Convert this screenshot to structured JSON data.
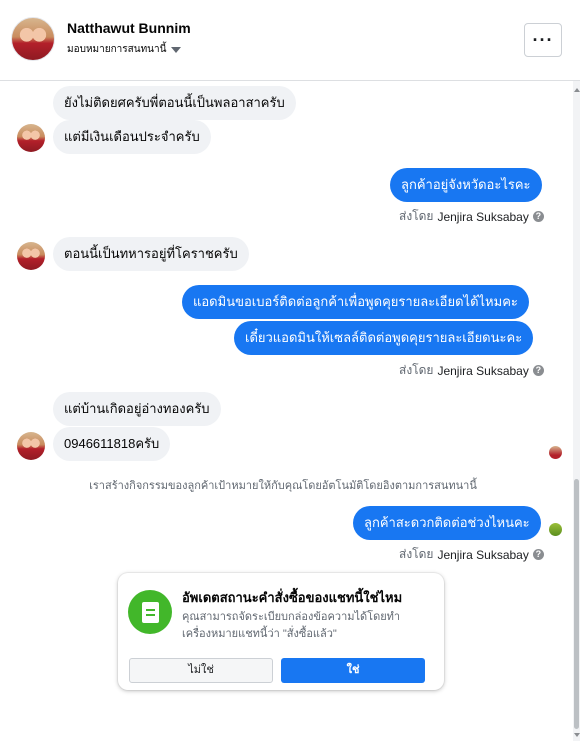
{
  "header": {
    "contact_name": "Natthawut Bunnim",
    "assign_label": "มอบหมายการสนทนานี้",
    "more_label": "···"
  },
  "messages": {
    "m1": "ยังไม่ติดยศครับพี่ตอนนี้เป็นพลอาสาครับ",
    "m2": "แต่มีเงินเดือนประจำครับ",
    "m3": "ลูกค้าอยู่จังหวัดอะไรคะ",
    "m4": "ตอนนี้เป็นทหารอยู่ที่โคราชครับ",
    "m5": "แอดมินขอเบอร์ติดต่อลูกค้าเพื่อพูดคุยรายละเอียดได้ไหมคะ",
    "m6": "เดี๋ยวแอดมินให้เซลล์ติดต่อพูดคุยรายละเอียดนะคะ",
    "m7": "แต่บ้านเกิดอยู่อ่างทองครับ",
    "m8": "0946611818ครับ",
    "m9": "ลูกค้าสะดวกติดต่อช่วงไหนคะ"
  },
  "sent_by": {
    "prefix": "ส่งโดย",
    "agent": "Jenjira Suksabay",
    "info": "?"
  },
  "system_note": "เราสร้างกิจกรรมของลูกค้าเป้าหมายให้กับคุณโดยอัตโนมัติโดยอิงตามการสนทนานี้",
  "card": {
    "title": "อัพเดตสถานะคำสั่งซื้อของแชทนี้ใช่ไหม",
    "description": "คุณสามารถจัดระเบียบกล่องข้อความได้โดยทำเครื่องหมายแชทนี้ว่า \"สั่งซื้อแล้ว\"",
    "no_label": "ไม่ใช่",
    "yes_label": "ใช่"
  },
  "colors": {
    "accent": "#1877f2",
    "incoming_bubble": "#f0f2f5",
    "order_icon": "#42b72a"
  }
}
